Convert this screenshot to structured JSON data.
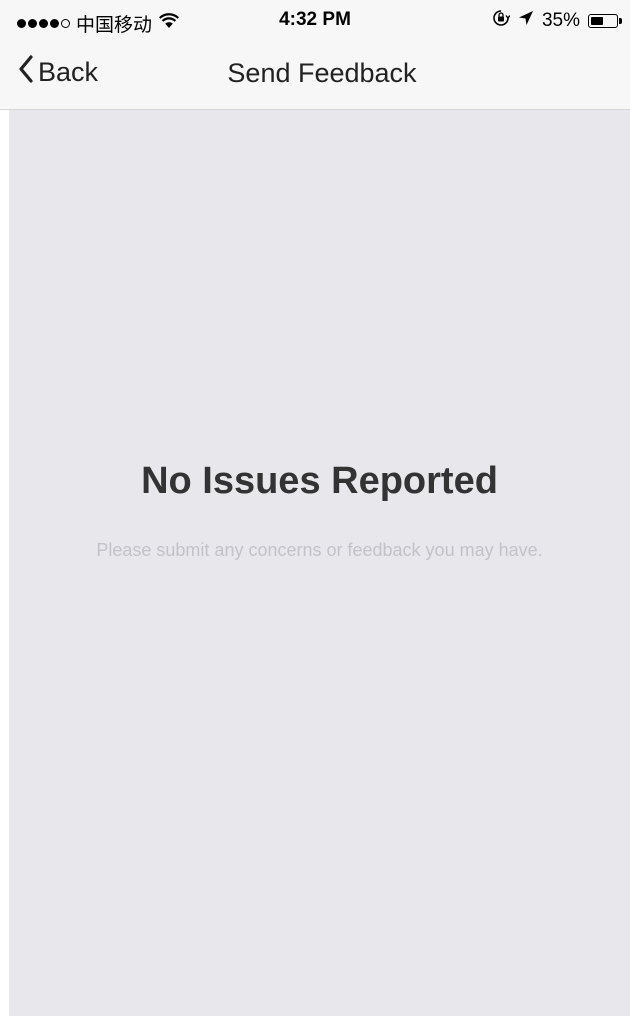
{
  "status_bar": {
    "carrier": "中国移动",
    "time": "4:32 PM",
    "battery_percent": "35%",
    "battery_level": 0.35,
    "icons": [
      "signal-dots-icon",
      "wifi-icon",
      "orientation-lock-icon",
      "location-arrow-icon",
      "battery-icon"
    ]
  },
  "nav": {
    "back_label": "Back",
    "title": "Send Feedback",
    "back_icon": "chevron-left-icon"
  },
  "empty_state": {
    "title": "No Issues Reported",
    "subtitle": "Please submit any concerns or feedback you may have."
  },
  "colors": {
    "content_background": "#e8e8ec",
    "bar_background": "#f7f7f7",
    "title_text": "#333333",
    "subtitle_text": "#c2c2c8"
  }
}
